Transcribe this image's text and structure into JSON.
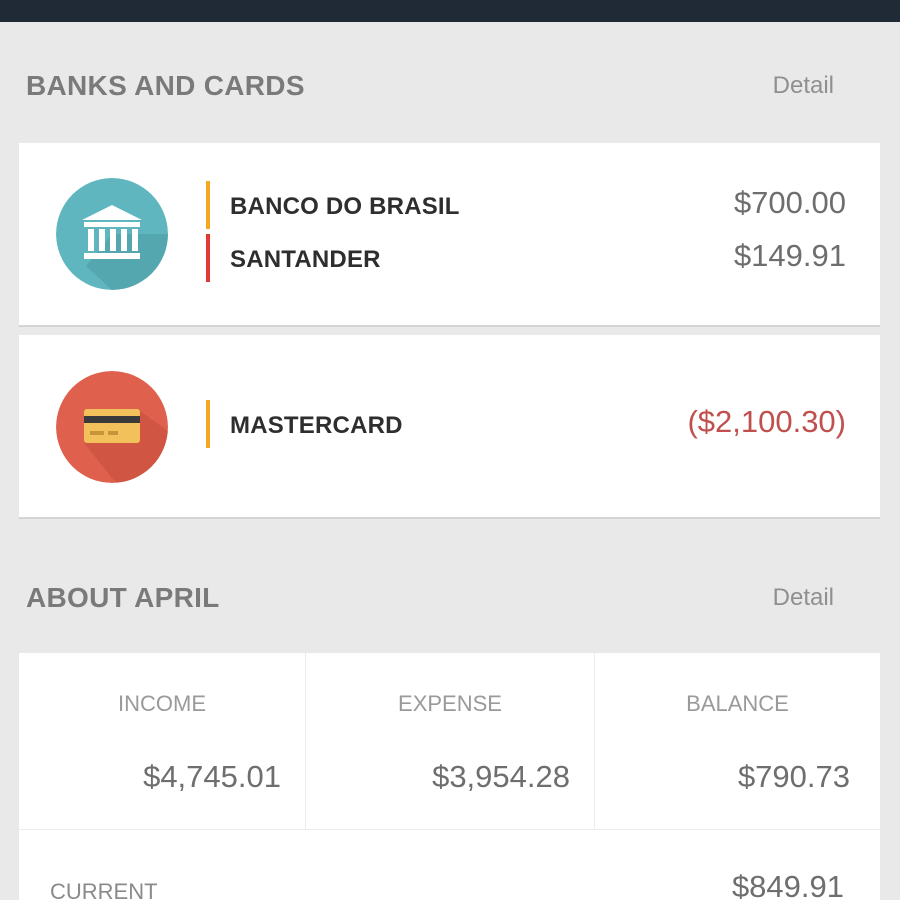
{
  "banks_section": {
    "title": "BANKS AND CARDS",
    "detail_label": "Detail"
  },
  "banks_card": {
    "icon": "bank-icon",
    "icon_color": "#5fb6be",
    "accounts": [
      {
        "name": "BANCO DO BRASIL",
        "amount": "$700.00",
        "bar_color": "#f5a623"
      },
      {
        "name": "SANTANDER",
        "amount": "$149.91",
        "bar_color": "#e53935"
      }
    ]
  },
  "cards_card": {
    "icon": "credit-card-icon",
    "icon_color": "#e0604e",
    "accounts": [
      {
        "name": "MASTERCARD",
        "amount": "($2,100.30)",
        "bar_color": "#f5a623",
        "amount_color": "#c0504d"
      }
    ]
  },
  "about_section": {
    "title": "ABOUT APRIL",
    "detail_label": "Detail"
  },
  "summary": {
    "income_label": "INCOME",
    "income_value": "$4,745.01",
    "expense_label": "EXPENSE",
    "expense_value": "$3,954.28",
    "balance_label": "BALANCE",
    "balance_value": "$790.73",
    "current_label": "CURRENT",
    "current_value": "$849.91"
  },
  "colors": {
    "topbar": "#1f2a36",
    "background": "#e9e9e9"
  }
}
